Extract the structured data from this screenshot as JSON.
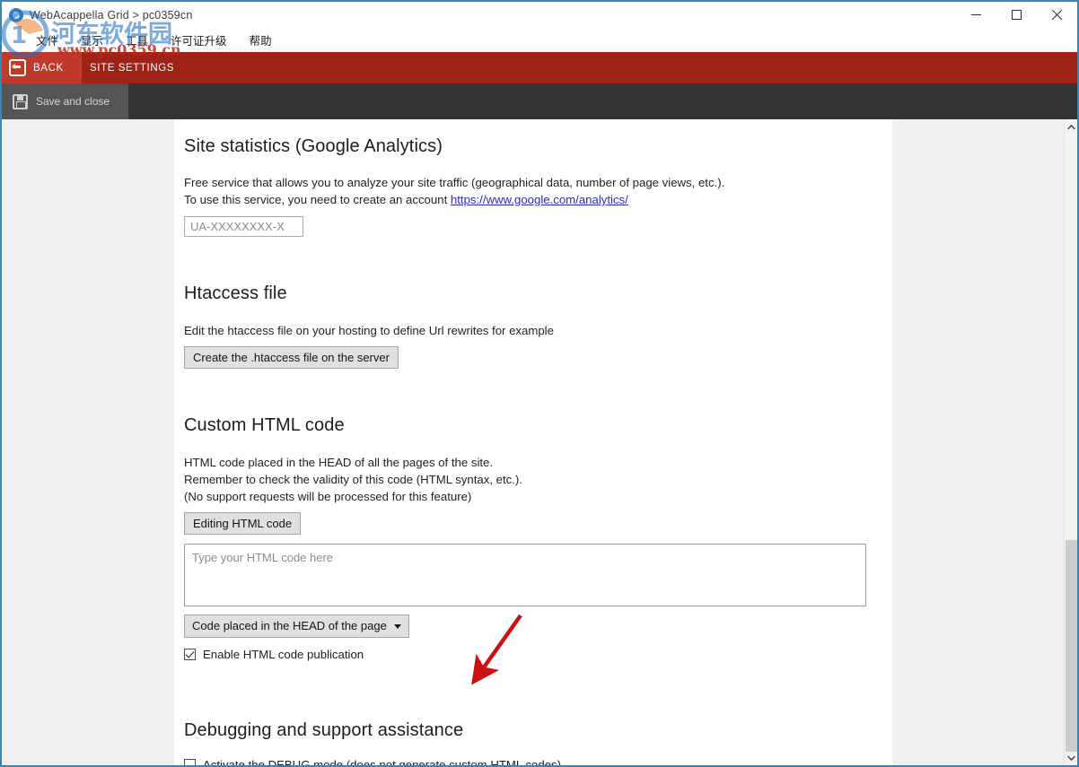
{
  "window": {
    "title": "WebAcappella Grid > pc0359cn",
    "app_icon": "app-logo-icon",
    "minimize_label": "minimize-icon",
    "maximize_label": "maximize-icon",
    "close_label": "close-icon"
  },
  "menubar": {
    "items": [
      {
        "label": "文件"
      },
      {
        "label": "显示"
      },
      {
        "label": "工具"
      },
      {
        "label": "许可证升级"
      },
      {
        "label": "帮助"
      }
    ]
  },
  "toolbar": {
    "back_label": "BACK",
    "breadcrumb_label": "SITE SETTINGS",
    "save_label": "Save and close",
    "accent_red": "#9e2218",
    "accent_red_light": "#c0392b",
    "dark_bar": "#333333",
    "save_block": "#555555"
  },
  "sections": {
    "analytics": {
      "heading": "Site statistics (Google Analytics)",
      "desc_line1": "Free service that allows you to analyze your site traffic (geographical data, number of page views, etc.).",
      "desc_line2_prefix": "To use this service, you need to create an account ",
      "link_text": "https://www.google.com/analytics/",
      "input_placeholder": "UA-XXXXXXXX-X",
      "input_value": ""
    },
    "htaccess": {
      "heading": "Htaccess file",
      "desc": "Edit the htaccess file on your hosting to define Url rewrites for example",
      "button_label": "Create the .htaccess file on the server"
    },
    "custom_html": {
      "heading": "Custom HTML code",
      "desc_line1": "HTML code placed in the HEAD of all the pages of the site.",
      "desc_line2": "Remember to check the validity of this code (HTML syntax, etc.).",
      "desc_line3": "(No support requests will be processed for this feature)",
      "edit_button_label": "Editing HTML code",
      "textarea_placeholder": "Type your HTML code here",
      "textarea_value": "",
      "placement_selected": "Code placed in the HEAD of the page",
      "placement_options": [
        "Code placed in the HEAD of the page"
      ],
      "enable_checkbox_label": "Enable HTML code publication",
      "enable_checkbox_checked": true
    },
    "debug": {
      "heading": "Debugging and support assistance",
      "checkbox_label": "Activate the DEBUG mode (does not generate custom HTML codes)",
      "checkbox_checked": false
    }
  },
  "scrollbar": {
    "up_arrow": "chevron-up-icon",
    "down_arrow": "chevron-down-icon"
  },
  "watermark": {
    "chinese_text": "河东软件园",
    "url_text": "www.pc0359.cn"
  }
}
